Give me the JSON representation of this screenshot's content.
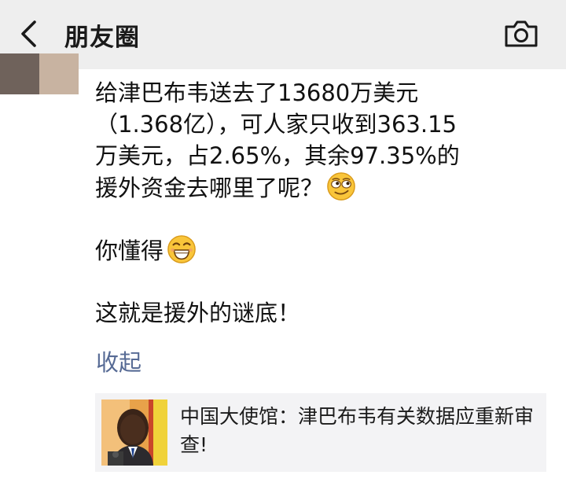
{
  "nav": {
    "title": "朋友圈",
    "back_icon": "chevron-left-icon",
    "camera_icon": "camera-icon",
    "background": "#eeeeee"
  },
  "post": {
    "paragraphs": [
      {
        "lines": [
          "给津巴布韦送去了13680万美元",
          "（1.368亿），可人家只收到363.15",
          "万美元，占2.65%，其余97.35%的",
          "援外资金去哪里了呢？"
        ],
        "emoji": "smirk-emoji"
      },
      {
        "lines": [
          "你懂得"
        ],
        "emoji": "grin-emoji"
      },
      {
        "lines": [
          "这就是援外的谜底！"
        ],
        "emoji": null
      }
    ],
    "collapse_label": "收起"
  },
  "share_card": {
    "title": "中国大使馆：津巴布韦有关数据应重新审查!"
  },
  "colors": {
    "link": "#576b95",
    "card_bg": "#f3f3f5",
    "text": "#111111"
  }
}
